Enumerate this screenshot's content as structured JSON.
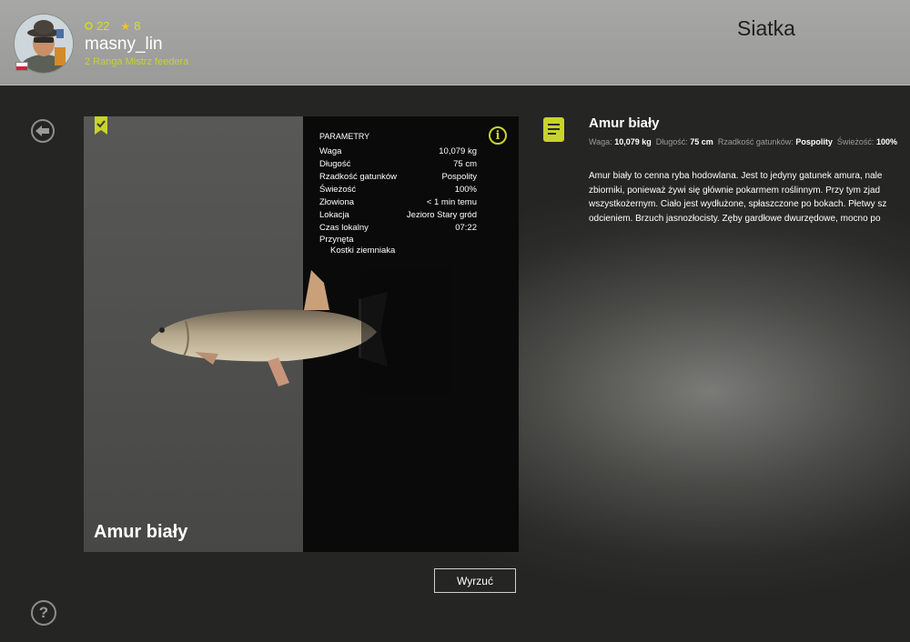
{
  "header": {
    "screen_title": "Siatka",
    "level": "22",
    "stars": "8",
    "username": "masny_lin",
    "rank": "2 Ranga Mistrz feedera"
  },
  "card": {
    "fish_name": "Amur biały",
    "params_title": "PARAMETRY",
    "params": [
      {
        "label": "Waga",
        "value": "10,079 kg"
      },
      {
        "label": "Długość",
        "value": "75 cm"
      },
      {
        "label": "Rzadkość gatunków",
        "value": "Pospolity"
      },
      {
        "label": "Świeżość",
        "value": "100%"
      },
      {
        "label": "Złowiona",
        "value": "< 1 min temu"
      },
      {
        "label": "Lokacja",
        "value": "Jezioro Stary gród"
      },
      {
        "label": "Czas lokalny",
        "value": "07:22"
      }
    ],
    "bait_label": "Przynęta",
    "bait_value": "Kostki ziemniaka"
  },
  "actions": {
    "discard_label": "Wyrzuć"
  },
  "description": {
    "title": "Amur biały",
    "summary": [
      {
        "label": "Waga:",
        "value": "10,079 kg"
      },
      {
        "label": "Długość:",
        "value": "75 cm"
      },
      {
        "label": "Rzadkość gatunków:",
        "value": "Pospolity"
      },
      {
        "label": "Świeżość:",
        "value": "100%"
      }
    ],
    "lines": [
      "Amur biały to cenna ryba hodowlana. Jest to jedyny gatunek amura, nale",
      "zbiorniki, ponieważ żywi się głównie pokarmem roślinnym. Przy tym zjad",
      "wszystkożernym. Ciało jest wydłużone, spłaszczone po bokach. Płetwy sz",
      "odcieniem. Brzuch jasnozłocisty. Zęby gardłowe dwurzędowe, mocno po"
    ]
  },
  "colors": {
    "accent": "#c9d32a",
    "star": "#f4c221",
    "panel": "#0a0a0a"
  },
  "icons": [
    "back-arrow-icon",
    "help-icon",
    "bookmark-icon",
    "info-icon",
    "document-icon"
  ]
}
